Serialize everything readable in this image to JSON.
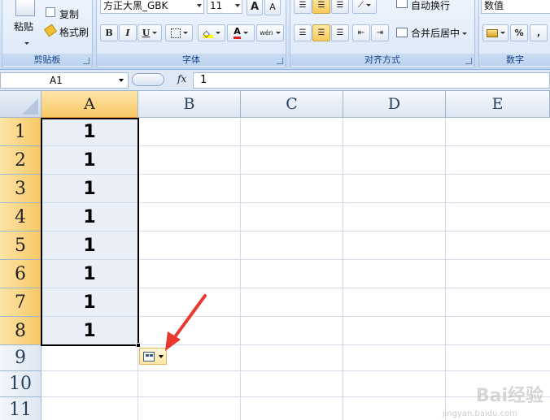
{
  "ribbon": {
    "clipboard": {
      "paste_label": "粘贴",
      "copy_label": "复制",
      "format_painter_label": "格式刷",
      "group_label": "剪贴板"
    },
    "font": {
      "font_name": "方正大黑_GBK",
      "font_size": "11",
      "bold_label": "B",
      "italic_label": "I",
      "underline_label": "U",
      "grow_label": "A",
      "shrink_label": "A",
      "font_color_label": "A",
      "phonetic_label": "wén",
      "group_label": "字体"
    },
    "alignment": {
      "wrap_text_label": "自动换行",
      "merge_center_label": "合并后居中",
      "group_label": "对齐方式"
    },
    "number": {
      "format_value": "数值",
      "percent_label": "%",
      "comma_label": ",",
      "group_label": "数字"
    }
  },
  "formula_bar": {
    "name_box": "A1",
    "fx_label": "fx",
    "formula_value": "1"
  },
  "sheet": {
    "columns": [
      "A",
      "B",
      "C",
      "D",
      "E"
    ],
    "rows": [
      "1",
      "2",
      "3",
      "4",
      "5",
      "6",
      "7",
      "8",
      "9",
      "10",
      "11"
    ],
    "column_a_values": [
      "1",
      "1",
      "1",
      "1",
      "1",
      "1",
      "1",
      "1"
    ],
    "selected_column": "A",
    "selected_range": "A1:A8"
  },
  "watermark": {
    "brand": "Bai经验",
    "url": "jingyan.baidu.com"
  },
  "colors": {
    "selection_header": "#f9c867",
    "annotation_arrow": "#e8382f",
    "ribbon_text": "#15428b"
  }
}
